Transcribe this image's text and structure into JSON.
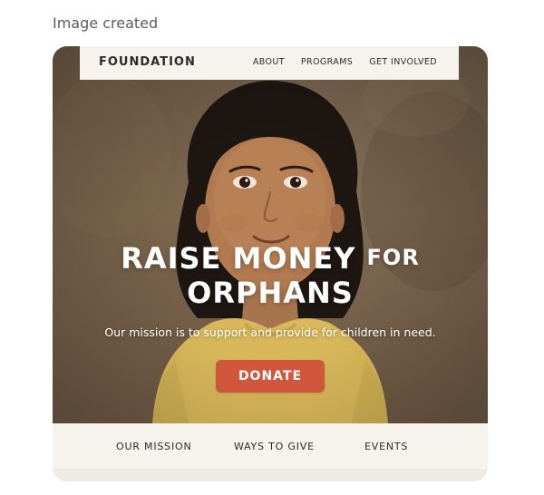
{
  "caption": "Image created",
  "navbar": {
    "brand": "FOUNDATION",
    "links": [
      "ABOUT",
      "PROGRAMS",
      "GET INVOLVED"
    ]
  },
  "hero": {
    "headline_line1_main": "RAISE MONEY",
    "headline_line1_small": "FOR",
    "headline_line2": "ORPHANS",
    "subtitle": "Our mission is to support and provide for children in need.",
    "donate_label": "DONATE"
  },
  "bottom_nav": {
    "links": [
      "OUR MISSION",
      "WAYS TO GIVE",
      "EVENTS"
    ]
  },
  "colors": {
    "accent": "#d0563c",
    "nav_background": "#f5f3ec",
    "shirt": "#d8b85a"
  }
}
